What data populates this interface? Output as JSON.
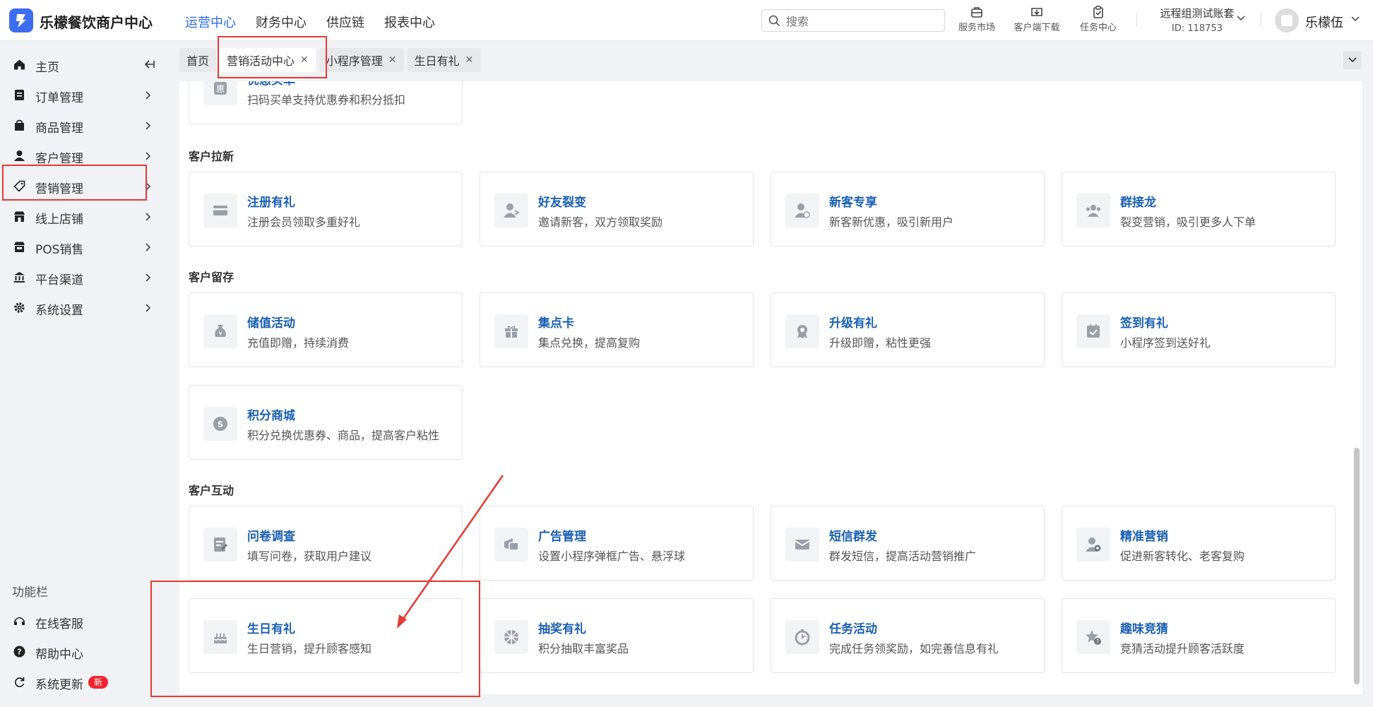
{
  "header": {
    "app_name": "乐檬餐饮商户中心",
    "nav": [
      "运营中心",
      "财务中心",
      "供应链",
      "报表中心"
    ],
    "nav_active_index": 0,
    "search_placeholder": "搜索",
    "tools": [
      {
        "label": "服务市场",
        "icon": "store-icon"
      },
      {
        "label": "客户端下载",
        "icon": "download-icon"
      },
      {
        "label": "任务中心",
        "icon": "clipboard-icon"
      }
    ],
    "account_name": "远程组测试账套",
    "account_id": "ID: 118753",
    "user_name": "乐檬伍"
  },
  "sidebar": {
    "items": [
      {
        "label": "主页",
        "icon": "home-icon"
      },
      {
        "label": "订单管理",
        "icon": "order-icon"
      },
      {
        "label": "商品管理",
        "icon": "goods-icon"
      },
      {
        "label": "客户管理",
        "icon": "user-icon"
      },
      {
        "label": "营销管理",
        "icon": "tag-icon"
      },
      {
        "label": "线上店铺",
        "icon": "shop-icon"
      },
      {
        "label": "POS销售",
        "icon": "pos-icon"
      },
      {
        "label": "平台渠道",
        "icon": "bank-icon"
      },
      {
        "label": "系统设置",
        "icon": "gear-icon"
      }
    ],
    "section_title": "功能栏",
    "footer_items": [
      {
        "label": "在线客服",
        "icon": "headset-icon"
      },
      {
        "label": "帮助中心",
        "icon": "help-icon"
      },
      {
        "label": "系统更新",
        "icon": "refresh-icon",
        "badge": "新"
      }
    ]
  },
  "tabs": [
    {
      "label": "首页",
      "closable": false
    },
    {
      "label": "营销活动中心",
      "closable": true,
      "active": true
    },
    {
      "label": "小程序管理",
      "closable": true
    },
    {
      "label": "生日有礼",
      "closable": true
    }
  ],
  "content": {
    "top_partial_card": {
      "title": "优惠买单",
      "desc": "扫码买单支持优惠券和积分抵扣"
    },
    "sections": [
      {
        "title": "客户拉新",
        "cards": [
          {
            "title": "注册有礼",
            "desc": "注册会员领取多重好礼",
            "icon": "card-icon"
          },
          {
            "title": "好友裂变",
            "desc": "邀请新客，双方领取奖励",
            "icon": "person-share-icon"
          },
          {
            "title": "新客专享",
            "desc": "新客新优惠，吸引新用户",
            "icon": "new-user-icon"
          },
          {
            "title": "群接龙",
            "desc": "裂变营销，吸引更多人下单",
            "icon": "group-icon"
          }
        ]
      },
      {
        "title": "客户留存",
        "cards": [
          {
            "title": "储值活动",
            "desc": "充值即赠，持续消费",
            "icon": "money-bag-icon"
          },
          {
            "title": "集点卡",
            "desc": "集点兑换，提高复购",
            "icon": "gift-icon"
          },
          {
            "title": "升级有礼",
            "desc": "升级即赠，粘性更强",
            "icon": "medal-icon"
          },
          {
            "title": "签到有礼",
            "desc": "小程序签到送好礼",
            "icon": "calendar-check-icon"
          },
          {
            "title": "积分商城",
            "desc": "积分兑换优惠券、商品，提高客户粘性",
            "icon": "coin-icon"
          }
        ]
      },
      {
        "title": "客户互动",
        "cards": [
          {
            "title": "问卷调查",
            "desc": "填写问卷，获取用户建议",
            "icon": "survey-icon"
          },
          {
            "title": "广告管理",
            "desc": "设置小程序弹框广告、悬浮球",
            "icon": "ad-icon"
          },
          {
            "title": "短信群发",
            "desc": "群发短信，提高活动营销推广",
            "icon": "sms-icon"
          },
          {
            "title": "精准营销",
            "desc": "促进新客转化、老客复购",
            "icon": "target-user-icon"
          },
          {
            "title": "生日有礼",
            "desc": "生日营销，提升顾客感知",
            "icon": "cake-icon"
          },
          {
            "title": "抽奖有礼",
            "desc": "积分抽取丰富奖品",
            "icon": "wheel-icon"
          },
          {
            "title": "任务活动",
            "desc": "完成任务领奖励，如完善信息有礼",
            "icon": "timer-icon"
          },
          {
            "title": "趣味竞猜",
            "desc": "竞猜活动提升顾客活跃度",
            "icon": "star-quiz-icon"
          }
        ]
      }
    ]
  },
  "colors": {
    "brand": "#3d6df0",
    "nav_active": "#2e6be6",
    "card_title": "#1a5fb4",
    "annotation": "#e53935",
    "badge": "#f5222d"
  }
}
